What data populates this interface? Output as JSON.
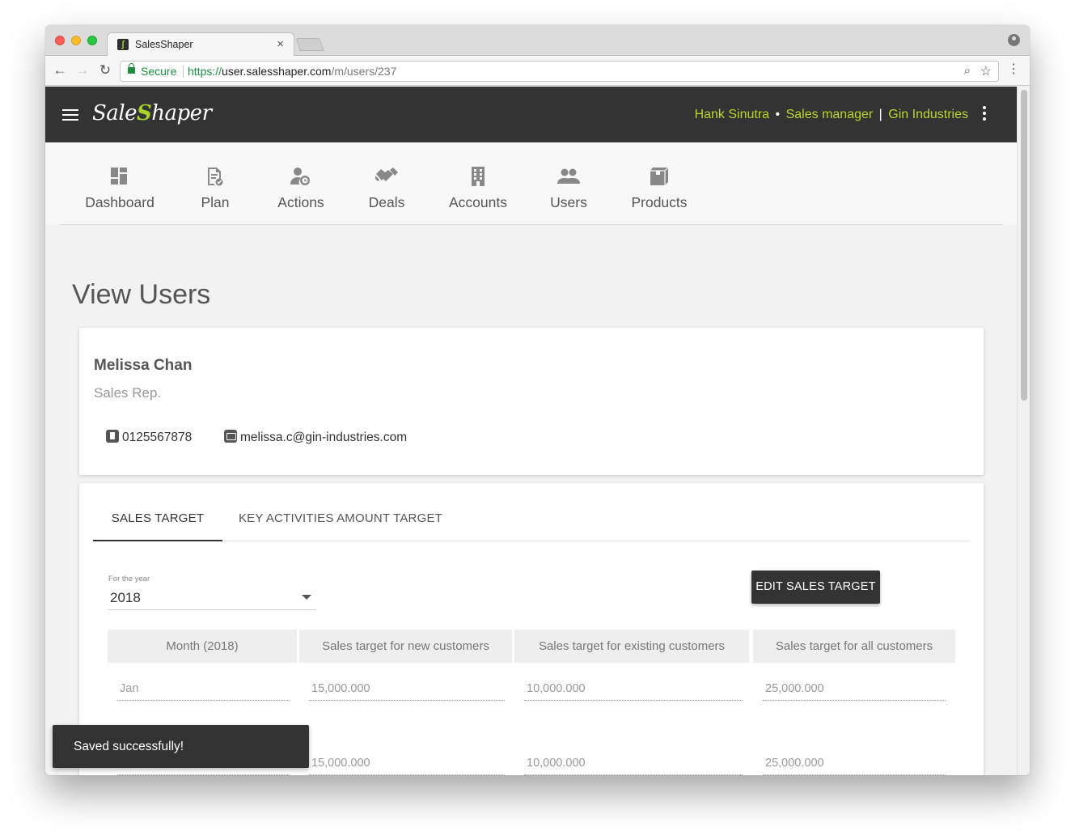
{
  "browser": {
    "tab_title": "SalesShaper",
    "tab_close": "×",
    "secure_label": "Secure",
    "url_scheme": "https://",
    "url_host": "user.salesshaper.com",
    "url_path": "/m/users/237"
  },
  "header": {
    "logo_text_1": "Sale",
    "logo_mark": "S",
    "logo_text_2": "haper",
    "user_name": "Hank Sinutra",
    "user_sep": "•",
    "user_role": "Sales manager",
    "company_sep": "|",
    "company": "Gin Industries"
  },
  "nav": {
    "items": [
      {
        "label": "Dashboard",
        "icon": "dashboard-icon"
      },
      {
        "label": "Plan",
        "icon": "plan-icon"
      },
      {
        "label": "Actions",
        "icon": "actions-icon"
      },
      {
        "label": "Deals",
        "icon": "deals-icon"
      },
      {
        "label": "Accounts",
        "icon": "accounts-icon"
      },
      {
        "label": "Users",
        "icon": "users-icon"
      },
      {
        "label": "Products",
        "icon": "products-icon"
      }
    ]
  },
  "page": {
    "title": "View Users"
  },
  "profile": {
    "name": "Melissa Chan",
    "role": "Sales Rep.",
    "phone": "0125567878",
    "email": "melissa.c@gin-industries.com"
  },
  "targets": {
    "tabs": [
      {
        "label": "SALES TARGET",
        "active": true
      },
      {
        "label": "KEY ACTIVITIES AMOUNT TARGET",
        "active": false
      }
    ],
    "year_label": "For the year",
    "year_value": "2018",
    "edit_button": "EDIT SALES TARGET",
    "columns": [
      "Month (2018)",
      "Sales target for new customers",
      "Sales target for existing customers",
      "Sales target for all customers"
    ],
    "rows": [
      {
        "month": "Jan",
        "new": "15,000.000",
        "existing": "10,000.000",
        "all": "25,000.000"
      },
      {
        "month": "",
        "new": "15,000.000",
        "existing": "10,000.000",
        "all": "25,000.000"
      }
    ]
  },
  "toast": {
    "message": "Saved successfully!"
  },
  "colors": {
    "header_bg": "#333333",
    "accent_green": "#b9d62a",
    "button_dark": "#333333"
  }
}
